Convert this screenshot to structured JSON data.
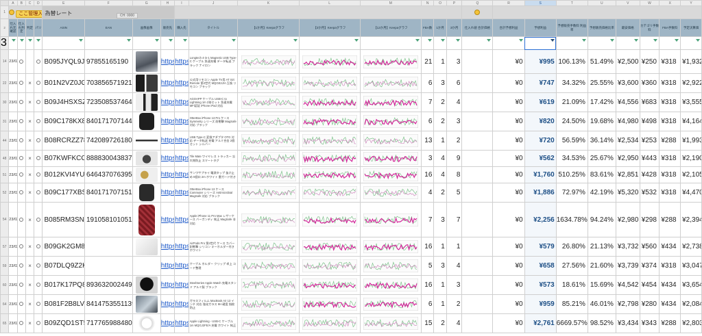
{
  "column_letters": [
    "A",
    "B",
    "C",
    "D",
    "E",
    "F",
    "G",
    "H",
    "I",
    "J",
    "K",
    "L",
    "M",
    "N",
    "O",
    "P",
    "Q",
    "R",
    "S",
    "T",
    "U",
    "V",
    "W",
    "X",
    "Y"
  ],
  "toolbar": {
    "button_label": "ここ管理入力",
    "title": "為替レート",
    "sub_label": "CH: 0000"
  },
  "headers": [
    "仕入れ元確認",
    "仕入れ判定",
    "判定",
    "パリ",
    "ASIN",
    "EAN",
    "画像画像",
    "販売先",
    "購入先",
    "タイトル",
    "【1か月】Keepaグラフ",
    "【3か月】Keepaグラフ",
    "【12か月】Keepaグラフ",
    "FBA数",
    "1か月",
    "3か月",
    "仕入れ値 合計価格",
    "合計予想利益",
    "予想利益",
    "予想販売手数料 利益率",
    "予想販売価格比率",
    "最安価格",
    "カテゴリ手数料",
    "FBA手数料",
    "予定決算価"
  ],
  "rows": [
    {
      "rn": "14",
      "date": "23/02/19",
      "judge": "",
      "asin": "B095JYQL9J",
      "jan": "97855165190",
      "thumb": "th-a",
      "link1": "https",
      "link2": "https",
      "title": "Longtech 4-in-1 Magnetic USB Type-C ケーブル 急速充電 データ転送 ブラック ナイロン",
      "fba": "21",
      "m1": "1",
      "m3": "3",
      "cost": "¥0",
      "profit": "¥995",
      "roi": "106.13%",
      "margin": "51.49%",
      "price": "¥2,500",
      "cat": "¥250",
      "fee": "¥318",
      "sell": "¥1,932"
    },
    {
      "rn": "22",
      "date": "23/02/19",
      "judge": "×",
      "asin": "B01N2VZ0JG",
      "jan": "703856571921",
      "thumb": "th-b",
      "link1": "https",
      "link2": "https",
      "title": "公式用リモコン Apple TV用 AT Siri Remote 第2世代 MQGE2J/A 互換 リモコン ブラック",
      "fba": "6",
      "m1": "3",
      "m3": "6",
      "cost": "¥0",
      "profit": "¥747",
      "roi": "34.32%",
      "margin": "25.55%",
      "price": "¥3,600",
      "cat": "¥360",
      "fee": "¥318",
      "sell": "¥2,922"
    },
    {
      "rn": "30",
      "date": "23/02/19",
      "judge": "×",
      "asin": "B09J4HSXSZ",
      "jan": "723508537464",
      "thumb": "th-c",
      "link1": "https",
      "link2": "https",
      "title": "AGOAPP ケーブル USB-C to Lightning 1m 2本セット 急速充電 MFi認証 iPhone iPad 対応",
      "fba": "7",
      "m1": "2",
      "m3": "4",
      "cost": "¥0",
      "profit": "¥619",
      "roi": "21.09%",
      "margin": "17.42%",
      "price": "¥4,556",
      "cat": "¥683",
      "fee": "¥318",
      "sell": "¥3,555"
    },
    {
      "rn": "31",
      "date": "23/02/19",
      "judge": "×",
      "asin": "B09C178KX8",
      "jan": "840171707144",
      "thumb": "th-d",
      "link1": "https",
      "link2": "https",
      "title": "OtterBox iPhone 13 Pro ケース Symmetry シリーズ 耐衝撃 MagSafe 対応 ブラック",
      "fba": "6",
      "m1": "2",
      "m3": "3",
      "cost": "¥0",
      "profit": "¥820",
      "roi": "24.50%",
      "margin": "19.68%",
      "price": "¥4,980",
      "cat": "¥498",
      "fee": "¥318",
      "sell": "¥4,164"
    },
    {
      "rn": "44",
      "date": "23/02/19",
      "judge": "×",
      "asin": "B08RCRZZ78",
      "jan": "742089726180",
      "thumb": "th-e",
      "link1": "https",
      "link2": "https",
      "title": "USB Type-C 変換アダプタ OTG 対応 データ転送 充電 アルミ合金 2個セット シルバー",
      "fba": "13",
      "m1": "1",
      "m3": "2",
      "cost": "¥0",
      "profit": "¥720",
      "roi": "56.59%",
      "margin": "36.14%",
      "price": "¥2,534",
      "cat": "¥253",
      "fee": "¥288",
      "sell": "¥1,993"
    },
    {
      "rn": "48",
      "date": "23/02/19",
      "judge": "×",
      "asin": "B07KWFKCCZ",
      "jan": "888830043837",
      "thumb": "th-f",
      "link1": "https",
      "link2": "https",
      "title": "Tile Mate ワイヤレス トラッカー 忘れ物防止 スマートタグ",
      "fba": "3",
      "m1": "4",
      "m3": "9",
      "cost": "¥0",
      "profit": "¥562",
      "roi": "34.53%",
      "margin": "25.67%",
      "price": "¥2,950",
      "cat": "¥443",
      "fee": "¥318",
      "sell": "¥2,190"
    },
    {
      "rn": "51",
      "date": "23/02/19",
      "judge": "×",
      "asin": "B012KVI4YU",
      "jan": "646437076395",
      "thumb": "th-g",
      "link1": "https",
      "link2": "https",
      "title": "サンワサプライ 電源タップ 抜け止め 6個口 2m ホワイト 雷ガード付き",
      "fba": "16",
      "m1": "4",
      "m3": "8",
      "cost": "¥0",
      "profit": "¥1,760",
      "roi": "510.25%",
      "margin": "83.61%",
      "price": "¥2,851",
      "cat": "¥428",
      "fee": "¥318",
      "sell": "¥2,105"
    },
    {
      "rn": "52",
      "date": "23/02/19",
      "judge": "×",
      "asin": "B09C177XBSX",
      "jan": "840171707151",
      "thumb": "th-h",
      "link1": "https",
      "link2": "https",
      "title": "OtterBox iPhone 13 ケース Commuter シリーズ Antimicrobial MagSafe 対応 ブラック",
      "fba": "4",
      "m1": "2",
      "m3": "5",
      "cost": "¥0",
      "profit": "¥1,886",
      "roi": "72.97%",
      "margin": "42.19%",
      "price": "¥5,320",
      "cat": "¥532",
      "fee": "¥318",
      "sell": "¥4,470"
    },
    {
      "rn": "54",
      "date": "23/02/19",
      "judge": "×",
      "asin": "B085RM3SN6",
      "jan": "191058101051",
      "thumb": "th-i",
      "link1": "https",
      "link2": "https",
      "title": "Apple iPhone 11 Pro Max レザーケース バーガンディ 純正 MagSafe 非対応",
      "fba": "7",
      "m1": "3",
      "m3": "7",
      "cost": "¥0",
      "profit": "¥2,256",
      "roi": "1634.78%",
      "margin": "94.24%",
      "price": "¥2,980",
      "cat": "¥298",
      "fee": "¥288",
      "sell": "¥2,394"
    },
    {
      "rn": "57",
      "date": "23/02/19",
      "judge": "×",
      "asin": "B09GK2GM8W",
      "jan": "",
      "thumb": "th-j",
      "link1": "https",
      "link2": "https",
      "title": "AirPods Pro 第2世代 ケース カバー 耐衝撃 シリコン キーホルダー付き ホワイト",
      "fba": "16",
      "m1": "1",
      "m3": "1",
      "cost": "¥0",
      "profit": "¥579",
      "roi": "26.80%",
      "margin": "21.13%",
      "price": "¥3,732",
      "cat": "¥560",
      "fee": "¥434",
      "sell": "¥2,738"
    },
    {
      "rn": "59",
      "date": "23/02/19",
      "judge": "×",
      "asin": "B07DLQ9Z2K",
      "jan": "",
      "thumb": "th-k",
      "link1": "https",
      "link2": "https",
      "title": "ケーブル ホルダー クリップ 卓上 コード整理",
      "fba": "5",
      "m1": "3",
      "m3": "4",
      "cost": "¥0",
      "profit": "¥658",
      "roi": "27.56%",
      "margin": "21.60%",
      "price": "¥3,739",
      "cat": "¥374",
      "fee": "¥318",
      "sell": "¥3,047"
    },
    {
      "rn": "60",
      "date": "23/02/19",
      "judge": "×",
      "asin": "B017K17PQ8",
      "jan": "893632002449",
      "thumb": "th-l",
      "link1": "https",
      "link2": "https",
      "title": "SteelSeries Apple Watch 充電スタンド アルミ製 ブラック",
      "fba": "16",
      "m1": "1",
      "m3": "3",
      "cost": "¥0",
      "profit": "¥573",
      "roi": "18.61%",
      "margin": "15.69%",
      "price": "¥4,542",
      "cat": "¥454",
      "fee": "¥434",
      "sell": "¥3,654"
    },
    {
      "rn": "64",
      "date": "23/02/19",
      "judge": "×",
      "asin": "B081F2B8LV",
      "jan": "8414753551139",
      "thumb": "th-m",
      "link1": "https",
      "link2": "https",
      "title": "ガラスフィルム MacBook Air 13 インチ 対応 強化ガラス 9H 硬度 指紋防止",
      "fba": "6",
      "m1": "1",
      "m3": "2",
      "cost": "¥0",
      "profit": "¥959",
      "roi": "85.21%",
      "margin": "46.01%",
      "price": "¥2,798",
      "cat": "¥280",
      "fee": "¥434",
      "sell": "¥2,084"
    },
    {
      "rn": "65",
      "date": "23/02/19",
      "judge": "×",
      "asin": "B09ZQD1ST5",
      "jan": "717765988480",
      "thumb": "th-n",
      "link1": "https",
      "link2": "https",
      "title": "Apple Lightning - USB-C ケーブル 1m MQGJ2FE/A 充電 ホワイト 純正",
      "fba": "15",
      "m1": "2",
      "m3": "4",
      "cost": "¥0",
      "profit": "¥2,761",
      "roi": "6669.57%",
      "margin": "98.52%",
      "price": "¥3,434",
      "cat": "¥343",
      "fee": "¥288",
      "sell": "¥2,803"
    }
  ]
}
